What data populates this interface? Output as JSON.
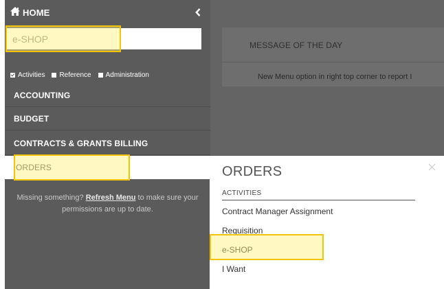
{
  "sidebar": {
    "home_label": "HOME",
    "search": {
      "value": "e-SHOP",
      "placeholder": ""
    },
    "filters": [
      {
        "label": "Activities",
        "checked": true
      },
      {
        "label": "Reference",
        "checked": false
      },
      {
        "label": "Administration",
        "checked": false
      }
    ],
    "items": [
      {
        "label": "ACCOUNTING"
      },
      {
        "label": "BUDGET"
      },
      {
        "label": "CONTRACTS & GRANTS BILLING"
      },
      {
        "label": "ORDERS"
      }
    ],
    "note": {
      "before": "Missing something? ",
      "link": "Refresh Menu",
      "after": " to make sure your permissions are up to date."
    }
  },
  "main": {
    "message_title": "MESSAGE OF THE DAY",
    "message_text": "New Menu option in right top corner to report I"
  },
  "flyout": {
    "title": "ORDERS",
    "section": "ACTIVITIES",
    "links": [
      {
        "label": "Contract Manager Assignment"
      },
      {
        "label": "Requisition"
      },
      {
        "label": "e-SHOP"
      },
      {
        "label": "I Want"
      }
    ]
  },
  "colors": {
    "sidebar_bg": "#5b5b5b",
    "main_bg": "#646464",
    "highlight_border": "#f5c400"
  },
  "icons": [
    "home-icon",
    "chevron-left-icon",
    "close-icon"
  ]
}
